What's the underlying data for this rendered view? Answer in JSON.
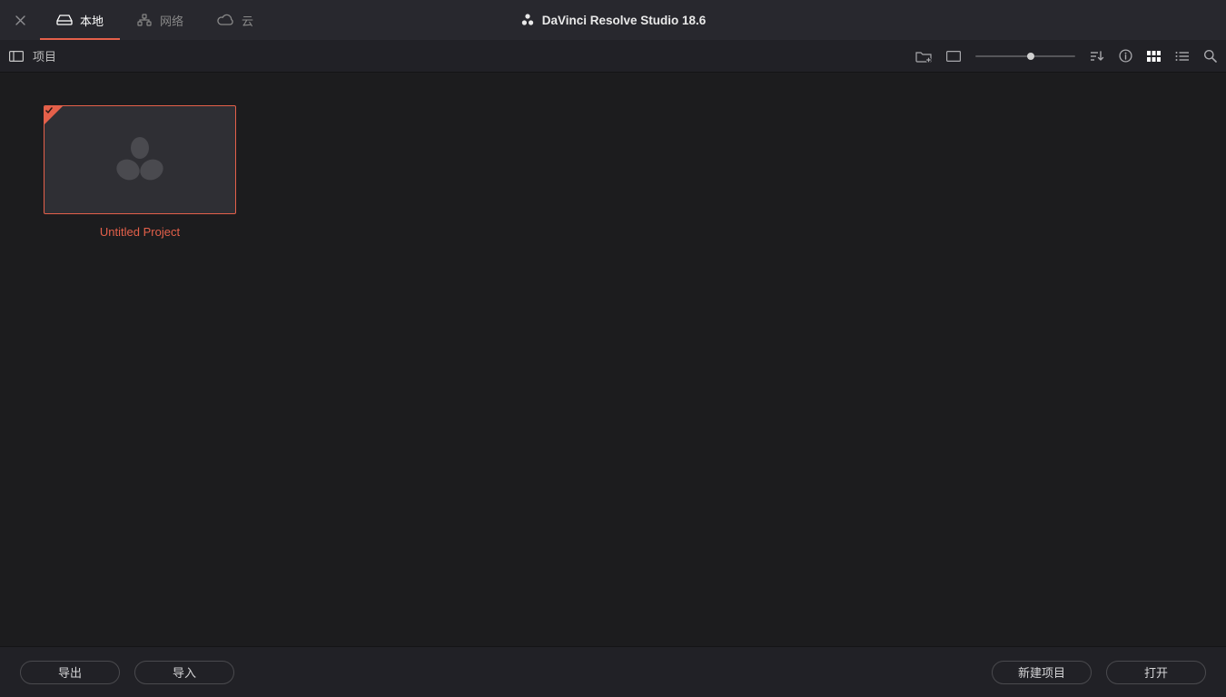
{
  "app": {
    "title": "DaVinci Resolve Studio 18.6"
  },
  "tabs": {
    "local": {
      "label": "本地",
      "active": true
    },
    "network": {
      "label": "网络",
      "active": false
    },
    "cloud": {
      "label": "云",
      "active": false
    }
  },
  "toolbar": {
    "section_label": "项目",
    "icons": {
      "sidebar": "sidebar-icon",
      "new_folder": "new-folder-icon",
      "fullscreen": "fullscreen-icon",
      "sort": "sort-icon",
      "info": "info-icon",
      "grid_view": "grid-view-icon",
      "list_view": "list-view-icon",
      "search": "search-icon"
    },
    "thumbnail_size": 55
  },
  "projects": [
    {
      "name": "Untitled Project",
      "selected": true,
      "checked": true
    }
  ],
  "footer": {
    "export": "导出",
    "import": "导入",
    "new_project": "新建项目",
    "open": "打开"
  },
  "colors": {
    "accent": "#e4604a"
  }
}
